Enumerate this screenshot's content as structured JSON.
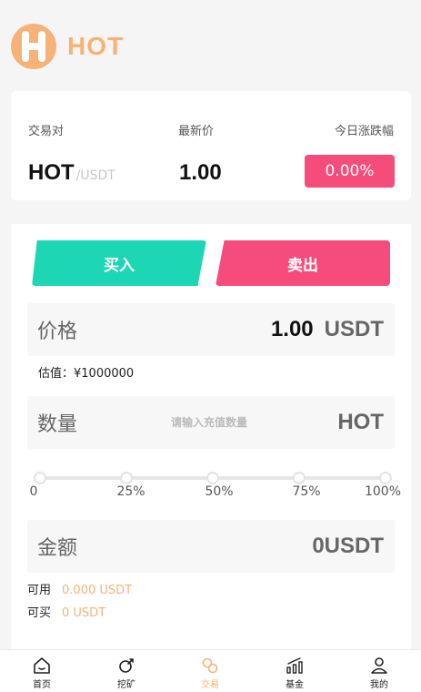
{
  "brand": {
    "name": "HOT"
  },
  "market": {
    "col_pair": "交易对",
    "col_price": "最新价",
    "col_change": "今日涨跌幅",
    "pair_base": "HOT",
    "pair_quote": "/USDT",
    "last_price": "1.00",
    "change": "0.00%"
  },
  "trade": {
    "buy_label": "买入",
    "sell_label": "卖出",
    "price_label": "价格",
    "price_value": "1.00",
    "price_unit": "USDT",
    "estimate": "估值：¥1000000",
    "qty_label": "数量",
    "qty_placeholder": "请输入充值数量",
    "qty_value": "",
    "qty_unit": "HOT",
    "slider_marks": [
      "0",
      "25%",
      "50%",
      "75%",
      "100%"
    ],
    "slider_value": 0,
    "amount_label": "金额",
    "amount_value": "0USDT",
    "available_label": "可用",
    "available_value": "0.000 USDT",
    "can_buy_label": "可买",
    "can_buy_value": "0 USDT"
  },
  "nav": {
    "items": [
      {
        "label": "首页",
        "icon": "home-icon"
      },
      {
        "label": "挖矿",
        "icon": "mining-icon"
      },
      {
        "label": "交易",
        "icon": "trade-icon",
        "active": true
      },
      {
        "label": "基金",
        "icon": "fund-icon"
      },
      {
        "label": "我的",
        "icon": "user-icon"
      }
    ]
  },
  "colors": {
    "accent": "#f7b278",
    "buy": "#1dd6b4",
    "sell": "#f64c7b"
  }
}
